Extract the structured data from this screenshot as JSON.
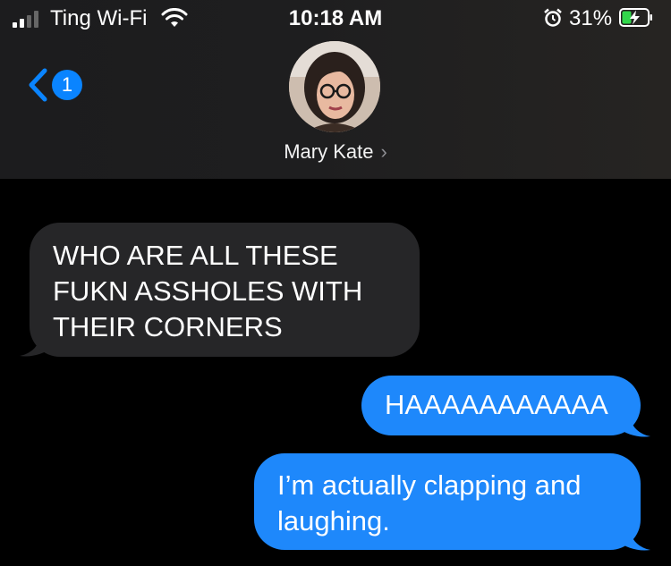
{
  "status_bar": {
    "carrier": "Ting Wi-Fi",
    "time": "10:18 AM",
    "battery_percent": "31%",
    "icons": [
      "signal-icon",
      "wifi-icon",
      "alarm-icon",
      "battery-charging-icon"
    ]
  },
  "header": {
    "back_badge_count": "1",
    "contact_name": "Mary Kate",
    "contact_chevron": "›"
  },
  "messages": [
    {
      "direction": "incoming",
      "text": "WHO ARE ALL THESE FUKN ASSHOLES WITH THEIR CORNERS"
    },
    {
      "direction": "outgoing",
      "text": "HAAAAAAAAAAA"
    },
    {
      "direction": "outgoing",
      "text": "I’m actually clapping and laughing."
    }
  ],
  "colors": {
    "outgoing_bubble": "#1e88fb",
    "incoming_bubble": "#262628",
    "accent": "#0a84ff",
    "background": "#000000"
  }
}
